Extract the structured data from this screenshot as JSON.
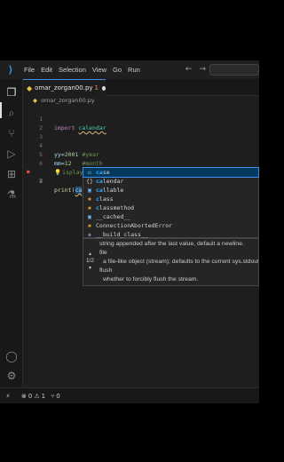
{
  "menu": [
    "File",
    "Edit",
    "Selection",
    "View",
    "Go",
    "Run"
  ],
  "icons": {
    "app": "vscode-logo-icon",
    "back": "arrow-left-icon",
    "forward": "arrow-right-icon",
    "explorer": "files-icon",
    "search": "search-icon",
    "scm": "source-control-icon",
    "run": "run-debug-icon",
    "extensions": "extensions-icon",
    "testing": "flask-icon",
    "account": "account-icon",
    "manage": "gear-icon"
  },
  "symbols": {
    "back": "←",
    "forward": "→",
    "python": "◆",
    "explorer_badge": "1",
    "remote": "⚡",
    "error": "⊗",
    "warning": "⚠",
    "ports": "⑂",
    "bulb": "💡",
    "err_mark": "●",
    "chevron_up": "▲",
    "chevron_down": "▼"
  },
  "tab": {
    "filename": "omar_zorgan00.py",
    "problems": "1"
  },
  "breadcrumb": {
    "filename": "omar_zorgan00.py"
  },
  "code": {
    "line_numbers": [
      "1",
      "2",
      "3",
      "4",
      "5",
      "6",
      "7",
      "8"
    ],
    "l1_kw": "import",
    "l1_mod": "calendar",
    "l4_var": "yy",
    "l4_eq": "=",
    "l4_num": "2001",
    "l4_cmt": "#year",
    "l5_var": "mm",
    "l5_eq": "=",
    "l5_num": "12",
    "l5_cmt": "#month",
    "l6_cmt": "isplay the calendar",
    "l7_fn": "print",
    "l7_paren": "(",
    "l7_typed": "ca"
  },
  "suggestions": [
    {
      "icon": "keyword-icon",
      "glyph": "▭",
      "cls": "i-kw",
      "match": "ca",
      "rest": "se"
    },
    {
      "icon": "module-icon",
      "glyph": "{}",
      "cls": "i-kw",
      "match": "ca",
      "rest": "lendar"
    },
    {
      "icon": "variable-icon",
      "glyph": "▣",
      "cls": "i-var",
      "match": "ca",
      "rest": "llable"
    },
    {
      "icon": "class-icon",
      "glyph": "✱",
      "cls": "i-cls",
      "match": "c",
      "rest": "lass"
    },
    {
      "icon": "class-icon",
      "glyph": "✱",
      "cls": "i-cls",
      "match": "c",
      "rest": "lassmethod"
    },
    {
      "icon": "variable-icon",
      "glyph": "▣",
      "cls": "i-var",
      "match": "",
      "rest": "__cached__"
    },
    {
      "icon": "class-icon",
      "glyph": "✱",
      "cls": "i-cls",
      "match": "",
      "rest": "ConnectionAbortedError"
    },
    {
      "icon": "function-icon",
      "glyph": "◈",
      "cls": "i-fn",
      "match": "",
      "rest": "__build_class__"
    }
  ],
  "docs": {
    "lines": [
      "string appended after the last value, default a newline.",
      "file",
      "a file-like object (stream); defaults to the current sys.stdout.",
      "flush",
      "whether to forcibly flush the stream."
    ],
    "page": "1/2"
  },
  "status": {
    "errors": "0",
    "warnings": "1",
    "ports": "0"
  }
}
